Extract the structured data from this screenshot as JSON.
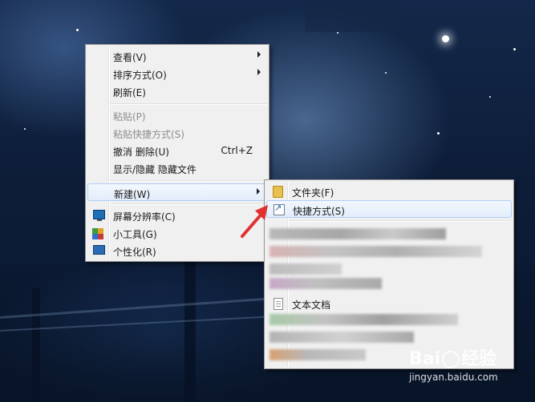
{
  "context_menu": {
    "items": [
      {
        "label": "查看(V)",
        "submenu": true
      },
      {
        "label": "排序方式(O)",
        "submenu": true
      },
      {
        "label": "刷新(E)"
      },
      {
        "label": "粘贴(P)",
        "disabled": true
      },
      {
        "label": "粘贴快捷方式(S)",
        "disabled": true
      },
      {
        "label": "撤消 删除(U)",
        "accelerator": "Ctrl+Z"
      },
      {
        "label": "显示/隐藏 隐藏文件"
      },
      {
        "label": "新建(W)",
        "submenu": true,
        "highlighted": true
      },
      {
        "label": "屏幕分辨率(C)",
        "icon": "monitor-icon"
      },
      {
        "label": "小工具(G)",
        "icon": "gadget-icon"
      },
      {
        "label": "个性化(R)",
        "icon": "personalize-icon"
      }
    ]
  },
  "new_submenu": {
    "items": [
      {
        "label": "文件夹(F)",
        "icon": "folder-icon"
      },
      {
        "label": "快捷方式(S)",
        "icon": "shortcut-icon",
        "highlighted": true
      },
      {
        "label": "文本文档",
        "icon": "text-document-icon"
      }
    ]
  },
  "watermark": {
    "logo_left": "Bai",
    "logo_right": "经验",
    "url": "jingyan.baidu.com"
  },
  "colors": {
    "menu_bg": "#f0f0f0",
    "highlight_border": "#aecff7",
    "arrow_red": "#e03030"
  }
}
